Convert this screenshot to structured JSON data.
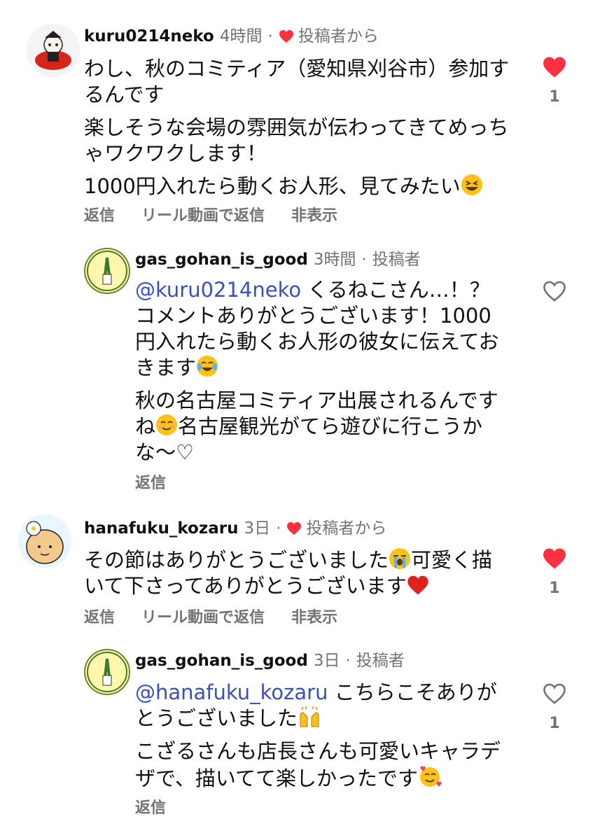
{
  "comments": [
    {
      "username": "kuru0214neko",
      "time": "4時間",
      "dot": "·",
      "badge": "投稿者から",
      "lines": [
        "わし、秋のコミティア（愛知県刈谷市）参加するんです",
        "楽しそうな会場の雰囲気が伝わってきてめっちゃワクワクします！",
        "1000円入れたら動くお人形、見てみたい"
      ],
      "emoji_line3": "grinning-squinting-face",
      "actions": [
        "返信",
        "リール動画で返信",
        "非表示"
      ],
      "liked": true,
      "like_count": "1"
    },
    {
      "username": "gas_gohan_is_good",
      "time": "3時間",
      "dot": "·",
      "badge": "投稿者",
      "mention": "@kuru0214neko",
      "p1_text": " くるねこさん…！？コメントありがとうございます！1000円入れたら動くお人形の彼女に伝えておきます",
      "p2a": "秋の名古屋コミティア出展されるんですね",
      "p2b": "名古屋観光がてら遊びに行こうかな〜♡",
      "actions": [
        "返信"
      ],
      "liked": false
    },
    {
      "username": "hanafuku_kozaru",
      "time": "3日",
      "dot": "·",
      "badge": "投稿者から",
      "p1a": "その節はありがとうございました",
      "p1b": "可愛く描いて下さってありがとうございます",
      "actions": [
        "返信",
        "リール動画で返信",
        "非表示"
      ],
      "liked": true,
      "like_count": "1"
    },
    {
      "username": "gas_gohan_is_good",
      "time": "3日",
      "dot": "·",
      "badge": "投稿者",
      "mention": "@hanafuku_kozaru",
      "p1_text": " こちらこそありがとうございました",
      "p2": "こざるさんも店長さんも可愛いキャラデザで、描いてて楽しかったです",
      "actions": [
        "返信"
      ],
      "liked": false,
      "like_count": "1"
    }
  ],
  "colors": {
    "like_red": "#ff3040",
    "mention": "#3b4fc4",
    "muted": "#737373"
  }
}
